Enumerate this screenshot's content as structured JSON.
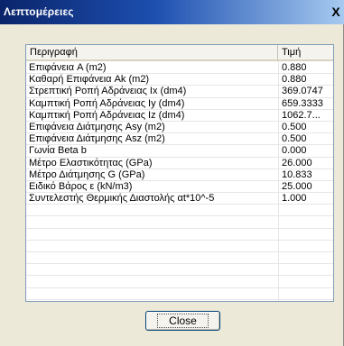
{
  "window": {
    "title": "Λεπτομέρειες",
    "close_glyph": "X"
  },
  "table": {
    "columns": [
      "Περιγραφή",
      "Τιμή"
    ],
    "rows": [
      {
        "desc": "Επιφάνεια  A (m2)",
        "value": "0.880"
      },
      {
        "desc": "Καθαρή Επιφάνεια     Ak (m2)",
        "value": "0.880"
      },
      {
        "desc": "Στρεπτική Ροπή Αδράνειας  Ix (dm4)",
        "value": "369.0747"
      },
      {
        "desc": "Καμπτική Ροπή Αδράνειας Iy (dm4)",
        "value": "659.3333"
      },
      {
        "desc": "Καμπτική Ροπή Αδράνειας Iz (dm4)",
        "value": "1062.7..."
      },
      {
        "desc": "Επιφάνεια Διάτμησης Asy (m2)",
        "value": "0.500"
      },
      {
        "desc": "Επιφάνεια Διάτμησης Asz (m2)",
        "value": "0.500"
      },
      {
        "desc": "Γωνία Beta  b",
        "value": "0.000"
      },
      {
        "desc": "Μέτρο Ελαστικότητας (GPa)",
        "value": "26.000"
      },
      {
        "desc": "Μέτρο Διάτμησης  G (GPa)",
        "value": "10.833"
      },
      {
        "desc": "Ειδικό Βάρος   ε  (kN/m3)",
        "value": "25.000"
      },
      {
        "desc": "Συντελεστής Θερμικής Διαστολής αt*10^-5",
        "value": "1.000"
      }
    ],
    "empty_rows": 8
  },
  "buttons": {
    "close_label": "Close"
  }
}
